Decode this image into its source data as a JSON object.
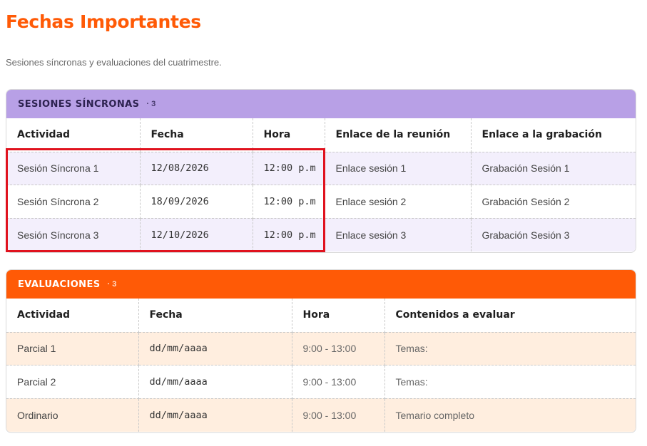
{
  "page": {
    "title": "Fechas Importantes",
    "subtitle": "Sesiones síncronas y evaluaciones del cuatrimestre."
  },
  "sync": {
    "title": "SESIONES SÍNCRONAS",
    "count": "· 3",
    "columns": [
      "Actividad",
      "Fecha",
      "Hora",
      "Enlace de la reunión",
      "Enlace a la grabación"
    ],
    "rows": [
      {
        "activity": "Sesión Síncrona 1",
        "date": "12/08/2026",
        "time": "12:00 p.m",
        "meeting": "Enlace sesión 1",
        "recording": "Grabación Sesión 1"
      },
      {
        "activity": "Sesión Síncrona 2",
        "date": "18/09/2026",
        "time": "12:00 p.m",
        "meeting": "Enlace sesión 2",
        "recording": "Grabación Sesión 2"
      },
      {
        "activity": "Sesión Síncrona 3",
        "date": "12/10/2026",
        "time": "12:00 p.m",
        "meeting": "Enlace sesión 3",
        "recording": "Grabación Sesión 3"
      }
    ],
    "header_color": "#b8a0e6",
    "row_tint": "#f3effc"
  },
  "eval": {
    "title": "EVALUACIONES",
    "count": "· 3",
    "columns": [
      "Actividad",
      "Fecha",
      "Hora",
      "Contenidos a evaluar"
    ],
    "rows": [
      {
        "activity": "Parcial 1",
        "date": "dd/mm/aaaa",
        "time": "9:00 - 13:00",
        "content": "Temas:"
      },
      {
        "activity": "Parcial 2",
        "date": "dd/mm/aaaa",
        "time": "9:00 - 13:00",
        "content": "Temas:"
      },
      {
        "activity": "Ordinario",
        "date": "dd/mm/aaaa",
        "time": "9:00 - 13:00",
        "content": "Temario completo"
      }
    ],
    "header_color": "#ff5a06",
    "row_tint": "#ffeedf"
  },
  "accent_color": "#ff5a06",
  "highlight_color": "#e0121e"
}
